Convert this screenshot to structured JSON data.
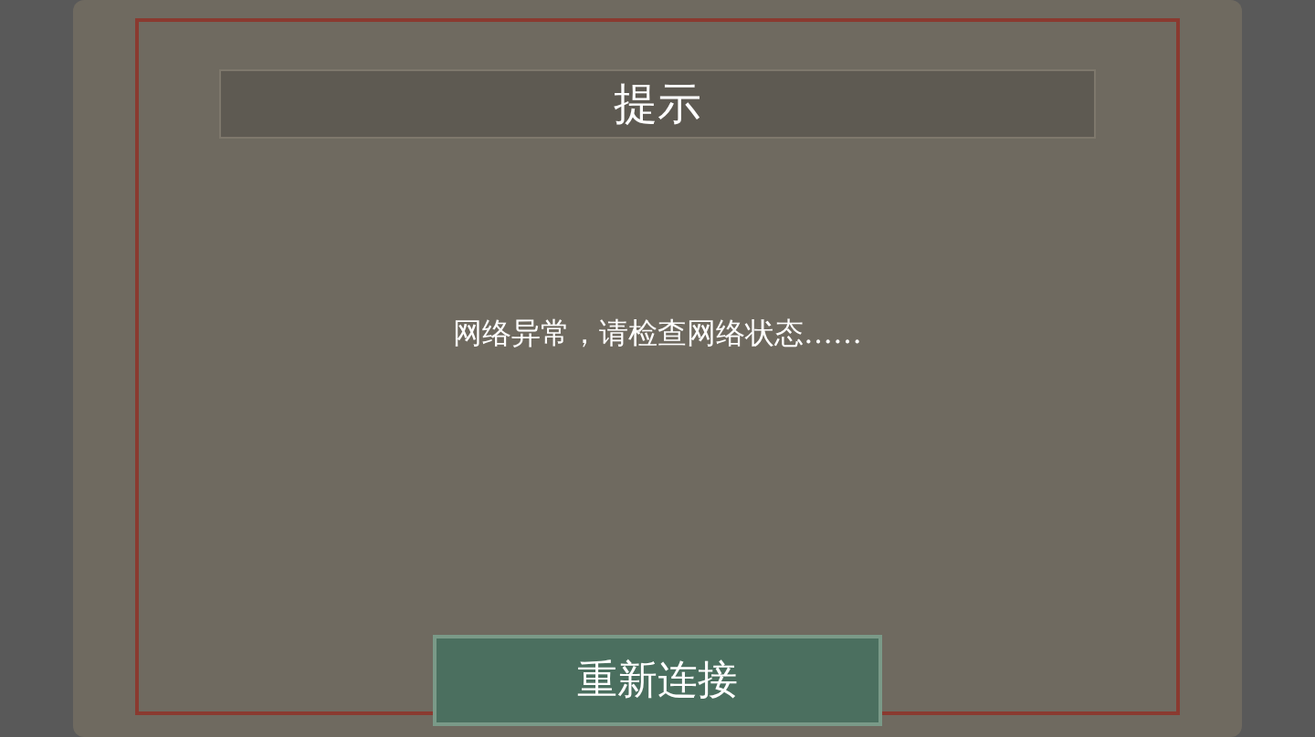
{
  "dialog": {
    "title": "提示",
    "message": "网络异常，请检查网络状态……",
    "button": "重新连接"
  }
}
